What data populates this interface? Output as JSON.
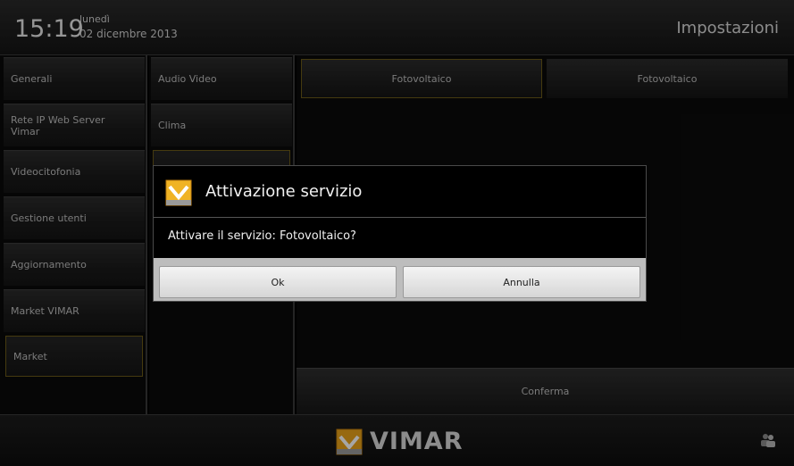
{
  "header": {
    "time": "15:19",
    "weekday": "lunedì",
    "date": "02 dicembre 2013",
    "title": "Impostazioni"
  },
  "menu_left": {
    "items": [
      {
        "label": "Generali"
      },
      {
        "label": "Rete IP Web Server Vimar"
      },
      {
        "label": "Videocitofonia"
      },
      {
        "label": "Gestione utenti"
      },
      {
        "label": "Aggiornamento"
      },
      {
        "label": "Market VIMAR"
      },
      {
        "label": "Market",
        "selected": true
      }
    ]
  },
  "menu_middle": {
    "items": [
      {
        "label": "Audio Video"
      },
      {
        "label": "Clima"
      },
      {
        "label": "",
        "selected": true
      }
    ]
  },
  "tabs": [
    {
      "label": "Fotovoltaico",
      "selected": true
    },
    {
      "label": "Fotovoltaico"
    }
  ],
  "confirm_label": "Conferma",
  "footer": {
    "brand": "VIMAR",
    "icon": "users-icon"
  },
  "dialog": {
    "title": "Attivazione servizio",
    "message": "Attivare il servizio: Fotovoltaico?",
    "ok_label": "Ok",
    "cancel_label": "Annulla",
    "icon": "vimar-logo-icon"
  },
  "colors": {
    "accent_gold": "#e8a21a",
    "selection_border": "#6b5a18"
  }
}
